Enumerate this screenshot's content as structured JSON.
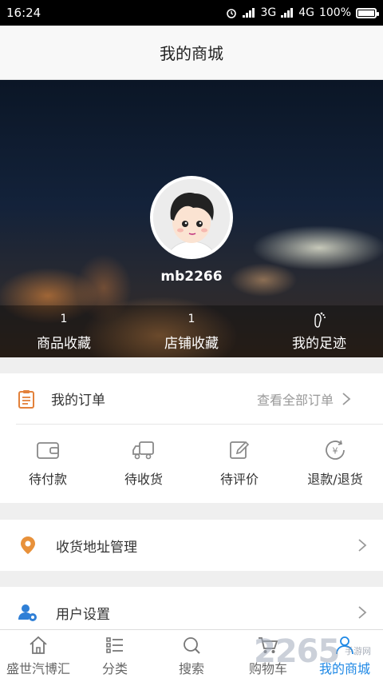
{
  "status_bar": {
    "time": "16:24",
    "network_1": "3G",
    "network_2": "4G",
    "battery": "100%"
  },
  "header": {
    "title": "我的商城"
  },
  "profile": {
    "username": "mb2266",
    "stats": [
      {
        "count": "1",
        "label": "商品收藏"
      },
      {
        "count": "1",
        "label": "店铺收藏"
      },
      {
        "count": "",
        "label": "我的足迹",
        "icon": "footprint-icon"
      }
    ]
  },
  "orders": {
    "title": "我的订单",
    "view_all": "查看全部订单",
    "actions": [
      {
        "label": "待付款",
        "icon": "wallet-icon"
      },
      {
        "label": "待收货",
        "icon": "truck-icon"
      },
      {
        "label": "待评价",
        "icon": "edit-icon"
      },
      {
        "label": "退款/退货",
        "icon": "refund-icon"
      }
    ]
  },
  "menu": {
    "address": {
      "label": "收货地址管理",
      "icon": "location-pin-icon"
    },
    "settings": {
      "label": "用户设置",
      "icon": "user-settings-icon"
    }
  },
  "bottom_nav": {
    "items": [
      {
        "label": "盛世汽博汇",
        "icon": "home-icon"
      },
      {
        "label": "分类",
        "icon": "list-icon"
      },
      {
        "label": "搜索",
        "icon": "search-icon"
      },
      {
        "label": "购物车",
        "icon": "cart-icon"
      },
      {
        "label": "我的商城",
        "icon": "person-icon",
        "active": true
      }
    ]
  },
  "watermark": {
    "main": "2265",
    "sub": "手游网"
  },
  "colors": {
    "accent": "#1e88e5",
    "order_icon": "#e3813a",
    "location_icon": "#e8913a",
    "settings_icon": "#2f7fd6"
  }
}
